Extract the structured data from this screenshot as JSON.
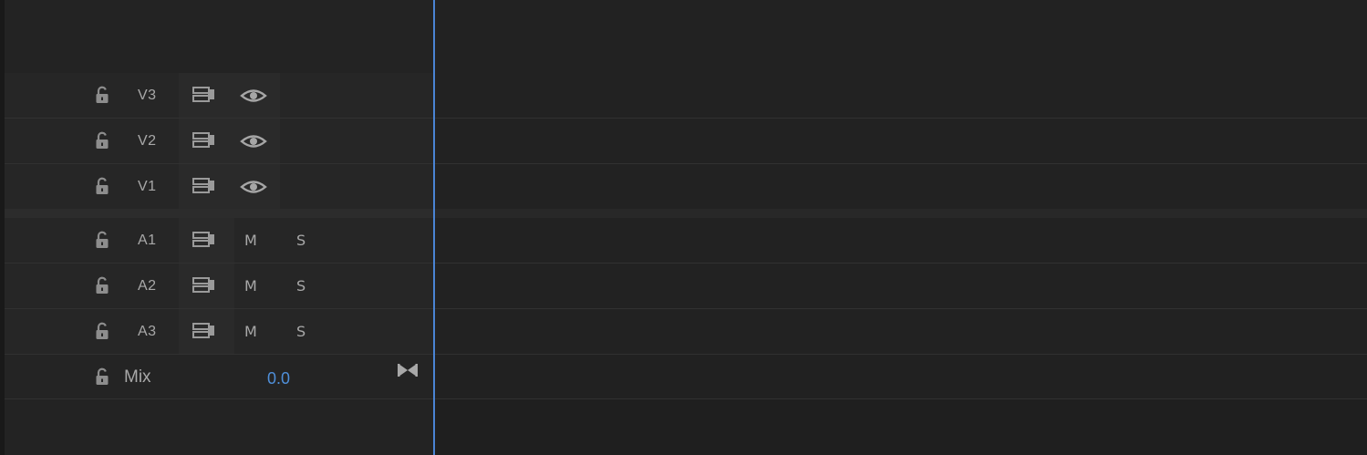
{
  "tracks": {
    "video": [
      {
        "label": "V3"
      },
      {
        "label": "V2"
      },
      {
        "label": "V1"
      }
    ],
    "audio": [
      {
        "label": "A1",
        "mute": "M",
        "solo": "S"
      },
      {
        "label": "A2",
        "mute": "M",
        "solo": "S"
      },
      {
        "label": "A3",
        "mute": "M",
        "solo": "S"
      }
    ],
    "mix": {
      "label": "Mix",
      "value": "0.0"
    }
  },
  "icons": {
    "lock": "lock-open-icon",
    "sync": "sync-lock-icon",
    "eye": "eye-icon",
    "bowtie": "bowtie-icon"
  },
  "colors": {
    "playhead": "#4a84d4",
    "mix_value": "#4f8fd9"
  }
}
